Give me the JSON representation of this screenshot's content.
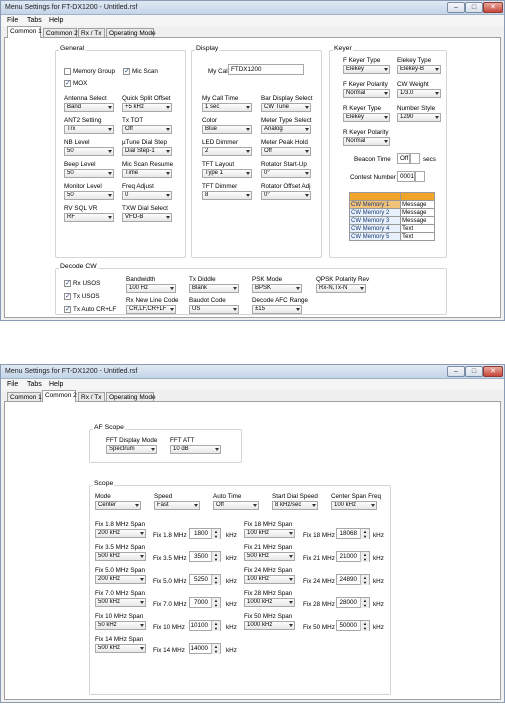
{
  "win1": {
    "title": "Menu Settings for FT-DX1200 - Untitled.rsf",
    "menus": [
      "File",
      "Tabs",
      "Help"
    ],
    "tabs": [
      "Common 1",
      "Common 2",
      "Rx / Tx",
      "Operating Mode"
    ],
    "general": {
      "title": "General",
      "checks": [
        {
          "label": "Memory Group",
          "checked": false
        },
        {
          "label": "Mic Scan",
          "checked": true
        },
        {
          "label": "MOX",
          "checked": true
        }
      ],
      "fields": [
        {
          "label": "Antenna Select",
          "value": "Band"
        },
        {
          "label": "Quick Split Offset",
          "value": "+5 kHz"
        },
        {
          "label": "ANT2 Setting",
          "value": "Trx"
        },
        {
          "label": "Tx TOT",
          "value": "Off"
        },
        {
          "label": "NB Level",
          "value": "50"
        },
        {
          "label": "µTune Dial Step",
          "value": "Dial Step-1"
        },
        {
          "label": "Beep Level",
          "value": "50"
        },
        {
          "label": "Mic Scan Resume",
          "value": "Time"
        },
        {
          "label": "Monitor Level",
          "value": "50"
        },
        {
          "label": "Freq Adjust",
          "value": "0"
        },
        {
          "label": "RV SQL VR",
          "value": "RF"
        },
        {
          "label": "TXW Dial Select",
          "value": "VFO-B"
        }
      ]
    },
    "display": {
      "title": "Display",
      "mycall_label": "My Call",
      "mycall_value": "FTDX1200",
      "fields": [
        {
          "label": "My Call Time",
          "value": "1 sec"
        },
        {
          "label": "Bar Display Select",
          "value": "CW Tune"
        },
        {
          "label": "Color",
          "value": "Blue"
        },
        {
          "label": "Meter Type Select",
          "value": "Analog"
        },
        {
          "label": "LED Dimmer",
          "value": "2"
        },
        {
          "label": "Meter Peak Hold",
          "value": "Off"
        },
        {
          "label": "TFT Layout",
          "value": "Type 1"
        },
        {
          "label": "Rotator Start-Up",
          "value": "0°"
        },
        {
          "label": "TFT Dimmer",
          "value": "8"
        },
        {
          "label": "Rotator Offset Adj",
          "value": "0°"
        }
      ]
    },
    "keyer": {
      "title": "Keyer",
      "fields": [
        {
          "label": "F Keyer Type",
          "value": "Elekey"
        },
        {
          "label": "Elekey Type",
          "value": "Elekey-B"
        },
        {
          "label": "F Keyer Polarity",
          "value": "Normal"
        },
        {
          "label": "CW Weight",
          "value": "1/3.0"
        },
        {
          "label": "R Keyer Type",
          "value": "Elekey"
        },
        {
          "label": "Number Style",
          "value": "1290"
        },
        {
          "label": "R Keyer Polarity",
          "value": "Normal"
        }
      ],
      "beacon_label": "Beacon Time",
      "beacon_value": "Off",
      "beacon_unit": "secs",
      "contest_label": "Contest Number",
      "contest_value": "0001",
      "memories": [
        {
          "name": "CW Memory 1",
          "type": "Message"
        },
        {
          "name": "CW Memory 2",
          "type": "Message"
        },
        {
          "name": "CW Memory 3",
          "type": "Message"
        },
        {
          "name": "CW Memory 4",
          "type": "Text"
        },
        {
          "name": "CW Memory 5",
          "type": "Text"
        }
      ]
    },
    "decode": {
      "title": "Decode CW",
      "checks": [
        {
          "label": "Rx USOS",
          "checked": true
        },
        {
          "label": "Tx USOS",
          "checked": true
        },
        {
          "label": "Tx Auto CR+LF",
          "checked": true
        }
      ],
      "fields": [
        {
          "label": "Bandwidth",
          "value": "100 Hz"
        },
        {
          "label": "Tx Diddle",
          "value": "Blank"
        },
        {
          "label": "PSK Mode",
          "value": "BPSK"
        },
        {
          "label": "QPSK Polarity Rev",
          "value": "Rx-N,Tx-N"
        },
        {
          "label": "Rx New Line Code",
          "value": "CR,LF,CR+LF"
        },
        {
          "label": "Baudot Code",
          "value": "US"
        },
        {
          "label": "Decode AFC Range",
          "value": "±15"
        }
      ]
    }
  },
  "win2": {
    "title": "Menu Settings for FT-DX1200 - Untitled.rsf",
    "menus": [
      "File",
      "Tabs",
      "Help"
    ],
    "tabs": [
      "Common 1",
      "Common 2",
      "Rx / Tx",
      "Operating Mode"
    ],
    "afscope": {
      "title": "AF Scope",
      "fields": [
        {
          "label": "FFT Display Mode",
          "value": "Spectrum"
        },
        {
          "label": "FFT ATT",
          "value": "10 dB"
        }
      ]
    },
    "scope": {
      "title": "Scope",
      "top": [
        {
          "label": "Mode",
          "value": "Center"
        },
        {
          "label": "Speed",
          "value": "Fast"
        },
        {
          "label": "Auto Time",
          "value": "Off"
        },
        {
          "label": "Start Dial Speed",
          "value": "8 kHz/sec"
        },
        {
          "label": "Center Span Freq",
          "value": "100 kHz"
        }
      ],
      "unit": "kHz",
      "left": [
        {
          "span_label": "Fix 1.8 MHz Span",
          "span": "200 kHz",
          "fix_label": "Fix 1.8 MHz",
          "fix": "1800"
        },
        {
          "span_label": "Fix 3.5 MHz Span",
          "span": "500 kHz",
          "fix_label": "Fix 3.5 MHz",
          "fix": "3500"
        },
        {
          "span_label": "Fix 5.0 MHz Span",
          "span": "200 kHz",
          "fix_label": "Fix 5.0 MHz",
          "fix": "5250"
        },
        {
          "span_label": "Fix 7.0 MHz Span",
          "span": "500 kHz",
          "fix_label": "Fix 7.0 MHz",
          "fix": "7000"
        },
        {
          "span_label": "Fix 10 MHz Span",
          "span": "50 kHz",
          "fix_label": "Fix 10 MHz",
          "fix": "10100"
        },
        {
          "span_label": "Fix 14 MHz Span",
          "span": "500 kHz",
          "fix_label": "Fix 14 MHz",
          "fix": "14000"
        }
      ],
      "right": [
        {
          "span_label": "Fix 18 MHz Span",
          "span": "100 kHz",
          "fix_label": "Fix 18 MHz",
          "fix": "18068"
        },
        {
          "span_label": "Fix 21 MHz Span",
          "span": "500 kHz",
          "fix_label": "Fix 21 MHz",
          "fix": "21000"
        },
        {
          "span_label": "Fix 24 MHz Span",
          "span": "100 kHz",
          "fix_label": "Fix 24 MHz",
          "fix": "24890"
        },
        {
          "span_label": "Fix 28 MHz Span",
          "span": "1000 kHz",
          "fix_label": "Fix 28 MHz",
          "fix": "28000"
        },
        {
          "span_label": "Fix 50 MHz Span",
          "span": "1000 kHz",
          "fix_label": "Fix 50 MHz",
          "fix": "50000"
        }
      ]
    }
  }
}
